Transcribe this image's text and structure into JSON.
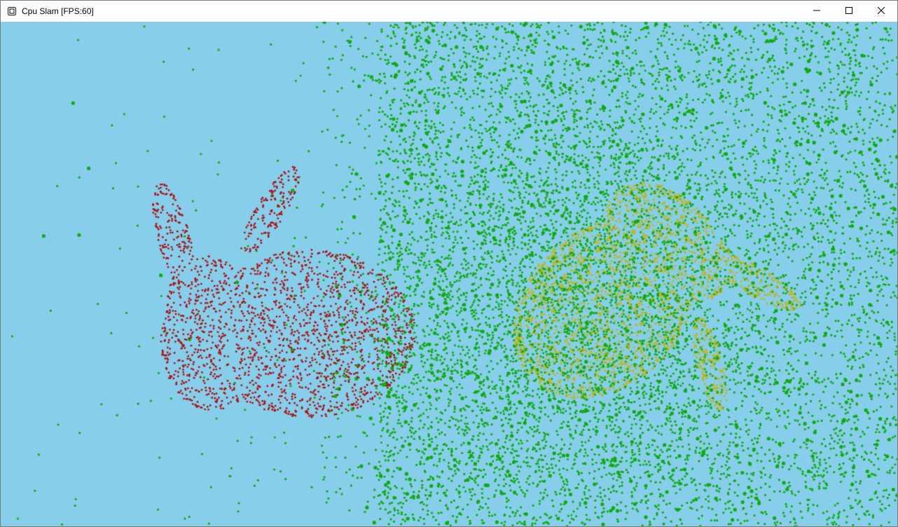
{
  "window": {
    "title": "Cpu Slam [FPS:60]",
    "icon": "app-window-icon"
  },
  "caption_buttons": {
    "minimize": "minimize-icon",
    "maximize": "maximize-icon",
    "close": "close-icon"
  },
  "scene": {
    "background_color": "#87CEEB",
    "noise_point_color": "#11AA11",
    "source_cloud_color": "#AA1111",
    "target_cloud_color": "#C8B400",
    "clouds": [
      {
        "name": "source-bunny",
        "color_key": "source_cloud_color"
      },
      {
        "name": "target-bunny",
        "color_key": "target_cloud_color"
      }
    ]
  }
}
